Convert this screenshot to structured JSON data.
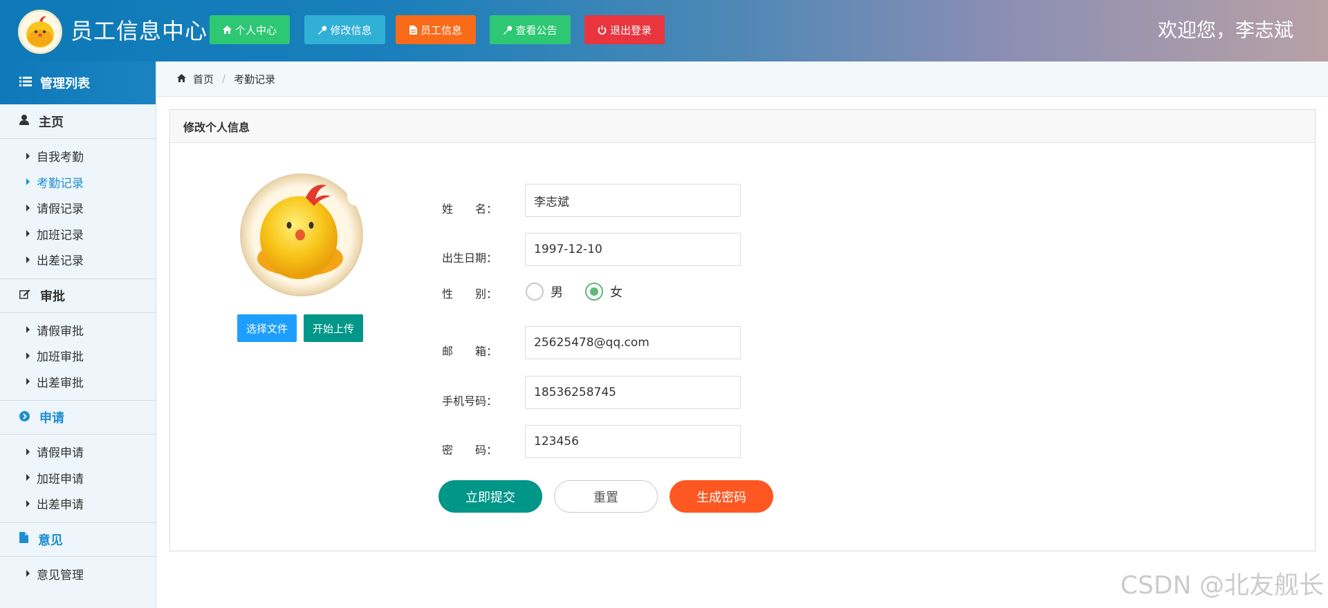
{
  "header": {
    "title": "员工信息中心",
    "welcome": "欢迎您，李志斌",
    "nav": [
      {
        "label": "个人中心",
        "icon": "home-icon",
        "color": "#2ec773"
      },
      {
        "label": "修改信息",
        "icon": "wrench-icon",
        "color": "#31b0d5"
      },
      {
        "label": "员工信息",
        "icon": "file-icon",
        "color": "#f96a19"
      },
      {
        "label": "查看公告",
        "icon": "wrench-icon",
        "color": "#2ec773"
      },
      {
        "label": "退出登录",
        "icon": "power-icon",
        "color": "#e8353e"
      }
    ]
  },
  "sidebar": {
    "header": "管理列表",
    "sections": [
      {
        "title": "主页",
        "icon": "user-icon",
        "items": [
          "自我考勤",
          "考勤记录",
          "请假记录",
          "加班记录",
          "出差记录"
        ],
        "active_item": "考勤记录"
      },
      {
        "title": "审批",
        "icon": "edit-icon",
        "items": [
          "请假审批",
          "加班审批",
          "出差审批"
        ]
      },
      {
        "title": "申请",
        "icon": "chevron-circle-right-icon",
        "items": [
          "请假申请",
          "加班申请",
          "出差申请"
        ],
        "active_section": true
      },
      {
        "title": "意见",
        "icon": "file-icon",
        "items": [
          "意见管理"
        ],
        "active_section": true
      }
    ]
  },
  "breadcrumb": {
    "home": "首页",
    "current": "考勤记录",
    "separator": "/"
  },
  "panel": {
    "title": "修改个人信息",
    "choose_file": "选择文件",
    "start_upload": "开始上传"
  },
  "form": {
    "name_label": "姓　　名：",
    "name_value": "李志斌",
    "birth_label": "出生日期：",
    "birth_value": "1997-12-10",
    "gender_label": "性　　别：",
    "gender_options": [
      "男",
      "女"
    ],
    "gender_selected": "女",
    "email_label": "邮　　箱：",
    "email_value": "25625478@qq.com",
    "phone_label": "手机号码：",
    "phone_value": "18536258745",
    "password_label": "密　　码：",
    "password_value": "123456",
    "submit": "立即提交",
    "reset": "重置",
    "generate": "生成密码"
  },
  "watermark": "CSDN @北友舰长"
}
